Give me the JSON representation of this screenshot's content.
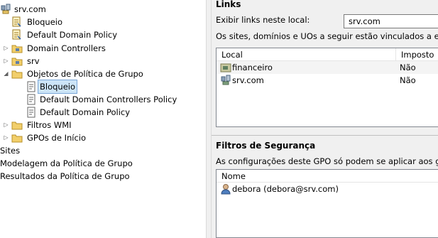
{
  "tree": {
    "root": "srv.com",
    "gpo_bloqueio": "Bloqueio",
    "gpo_ddp": "Default Domain Policy",
    "ou_dc": "Domain Controllers",
    "ou_srv": "srv",
    "gpo_objects": "Objetos de Política de Grupo",
    "obj_bloqueio": "Bloqueio",
    "obj_ddcp": "Default Domain Controllers Policy",
    "obj_ddp": "Default Domain Policy",
    "wmi": "Filtros WMI",
    "starter": "GPOs de Início",
    "sites": "Sites",
    "modeling": "Modelagem da Política de Grupo",
    "results": "Resultados da Política de Grupo"
  },
  "links": {
    "heading": "Links",
    "location_label": "Exibir links neste local:",
    "location_value": "srv.com",
    "info": "Os sites, domínios e UOs a seguir estão vinculados a este GPO:",
    "columns": [
      "Local",
      "Imposto"
    ],
    "rows": [
      {
        "local": "financeiro",
        "imposto": "Não"
      },
      {
        "local": "srv.com",
        "imposto": "Não"
      }
    ]
  },
  "security": {
    "heading": "Filtros de Segurança",
    "info": "As configurações deste GPO só podem se aplicar aos grupos, usuá",
    "column": "Nome",
    "rows": [
      {
        "name": "debora (debora@srv.com)"
      }
    ]
  },
  "colors": {
    "selection_bg": "#cce4f7",
    "selection_border": "#7aa7d8",
    "panel_bg": "#f0f0f0"
  }
}
